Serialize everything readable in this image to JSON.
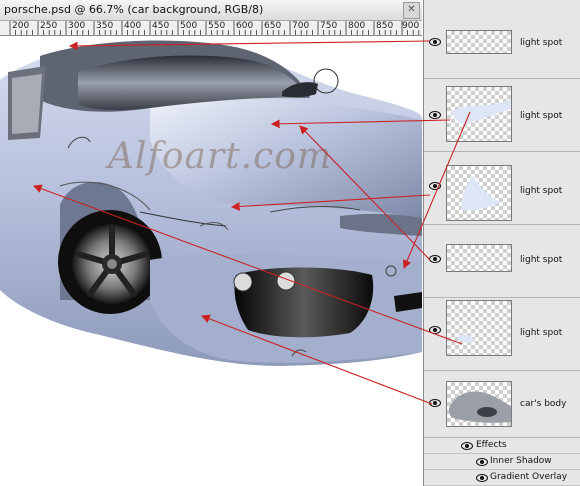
{
  "document": {
    "title": "porsche.psd @ 66.7% (car background, RGB/8)",
    "ruler_labels": [
      "200",
      "250",
      "300",
      "350",
      "400",
      "450",
      "500",
      "550",
      "600",
      "650",
      "700",
      "750",
      "800",
      "850",
      "900"
    ],
    "watermark": "Alfoart.com"
  },
  "layers_panel": {
    "layers": [
      {
        "name": "light spot",
        "visible": true
      },
      {
        "name": "light spot",
        "visible": true
      },
      {
        "name": "light spot",
        "visible": true
      },
      {
        "name": "light spot",
        "visible": true
      },
      {
        "name": "light spot",
        "visible": true
      },
      {
        "name": "car's body",
        "visible": true
      }
    ],
    "effects": {
      "label": "Effects",
      "items": [
        "Inner Shadow",
        "Gradient Overlay"
      ]
    }
  },
  "colors": {
    "car_body": "#b7c1dc",
    "arrow": "#cc2222",
    "panel_bg": "#e4e4e4"
  },
  "icons": [
    "eye-icon",
    "close-icon"
  ]
}
